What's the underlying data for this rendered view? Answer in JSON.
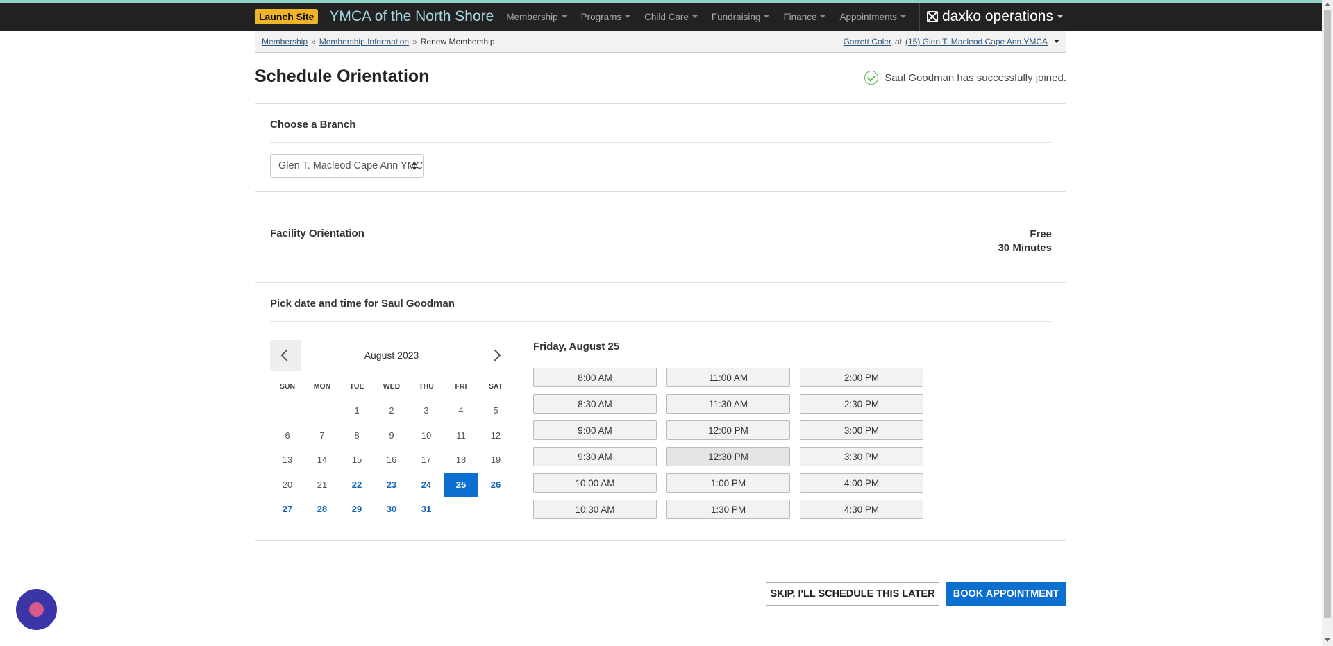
{
  "header": {
    "launch_label": "Launch Site",
    "brand": "YMCA of the North Shore",
    "menu": [
      {
        "label": "Membership"
      },
      {
        "label": "Programs"
      },
      {
        "label": "Child Care"
      },
      {
        "label": "Fundraising"
      },
      {
        "label": "Finance"
      },
      {
        "label": "Appointments"
      }
    ],
    "daxko_label": "daxko operations"
  },
  "breadcrumb": {
    "items": [
      "Membership",
      "Membership Information"
    ],
    "separator": "»",
    "current": "Renew Membership"
  },
  "user": {
    "name": "Garrett Coler",
    "at": "at",
    "location": "(15) Glen T. Macleod Cape Ann YMCA"
  },
  "page": {
    "title": "Schedule Orientation",
    "success_message": "Saul Goodman has successfully joined."
  },
  "branch": {
    "heading": "Choose a Branch",
    "selected": "Glen T. Macleod Cape Ann YMCA"
  },
  "facility": {
    "heading": "Facility Orientation",
    "price": "Free",
    "duration": "30 Minutes"
  },
  "picker": {
    "heading": "Pick date and time for Saul Goodman",
    "month_label": "August 2023",
    "weekdays": [
      "SUN",
      "MON",
      "TUE",
      "WED",
      "THU",
      "FRI",
      "SAT"
    ],
    "first_weekday_index": 2,
    "days": [
      {
        "d": "1",
        "s": "n"
      },
      {
        "d": "2",
        "s": "n"
      },
      {
        "d": "3",
        "s": "n"
      },
      {
        "d": "4",
        "s": "n"
      },
      {
        "d": "5",
        "s": "n"
      },
      {
        "d": "6",
        "s": "n"
      },
      {
        "d": "7",
        "s": "n"
      },
      {
        "d": "8",
        "s": "n"
      },
      {
        "d": "9",
        "s": "n"
      },
      {
        "d": "10",
        "s": "n"
      },
      {
        "d": "11",
        "s": "n"
      },
      {
        "d": "12",
        "s": "n"
      },
      {
        "d": "13",
        "s": "n"
      },
      {
        "d": "14",
        "s": "n"
      },
      {
        "d": "15",
        "s": "n"
      },
      {
        "d": "16",
        "s": "n"
      },
      {
        "d": "17",
        "s": "n"
      },
      {
        "d": "18",
        "s": "n"
      },
      {
        "d": "19",
        "s": "n"
      },
      {
        "d": "20",
        "s": "n"
      },
      {
        "d": "21",
        "s": "n"
      },
      {
        "d": "22",
        "s": "a"
      },
      {
        "d": "23",
        "s": "a"
      },
      {
        "d": "24",
        "s": "a"
      },
      {
        "d": "25",
        "s": "sel"
      },
      {
        "d": "26",
        "s": "a"
      },
      {
        "d": "27",
        "s": "a"
      },
      {
        "d": "28",
        "s": "a"
      },
      {
        "d": "29",
        "s": "a"
      },
      {
        "d": "30",
        "s": "a"
      },
      {
        "d": "31",
        "s": "a"
      }
    ],
    "selected_date_label": "Friday, August 25",
    "times": [
      "8:00 AM",
      "8:30 AM",
      "9:00 AM",
      "9:30 AM",
      "10:00 AM",
      "10:30 AM",
      "11:00 AM",
      "11:30 AM",
      "12:00 PM",
      "12:30 PM",
      "1:00 PM",
      "1:30 PM",
      "2:00 PM",
      "2:30 PM",
      "3:00 PM",
      "3:30 PM",
      "4:00 PM",
      "4:30 PM"
    ],
    "hovered_time": "12:30 PM"
  },
  "actions": {
    "skip_label": "SKIP, I'LL SCHEDULE THIS LATER",
    "book_label": "BOOK APPOINTMENT"
  },
  "colors": {
    "accent": "#0b6fd0",
    "launch": "#f0b429",
    "nav_bg": "#222222",
    "success": "#5cb85c",
    "chat": "#3b35a8"
  },
  "icons": {
    "prev": "chevron-left-icon",
    "next": "chevron-right-icon",
    "success": "check-circle-icon",
    "chat": "chat-icon"
  }
}
